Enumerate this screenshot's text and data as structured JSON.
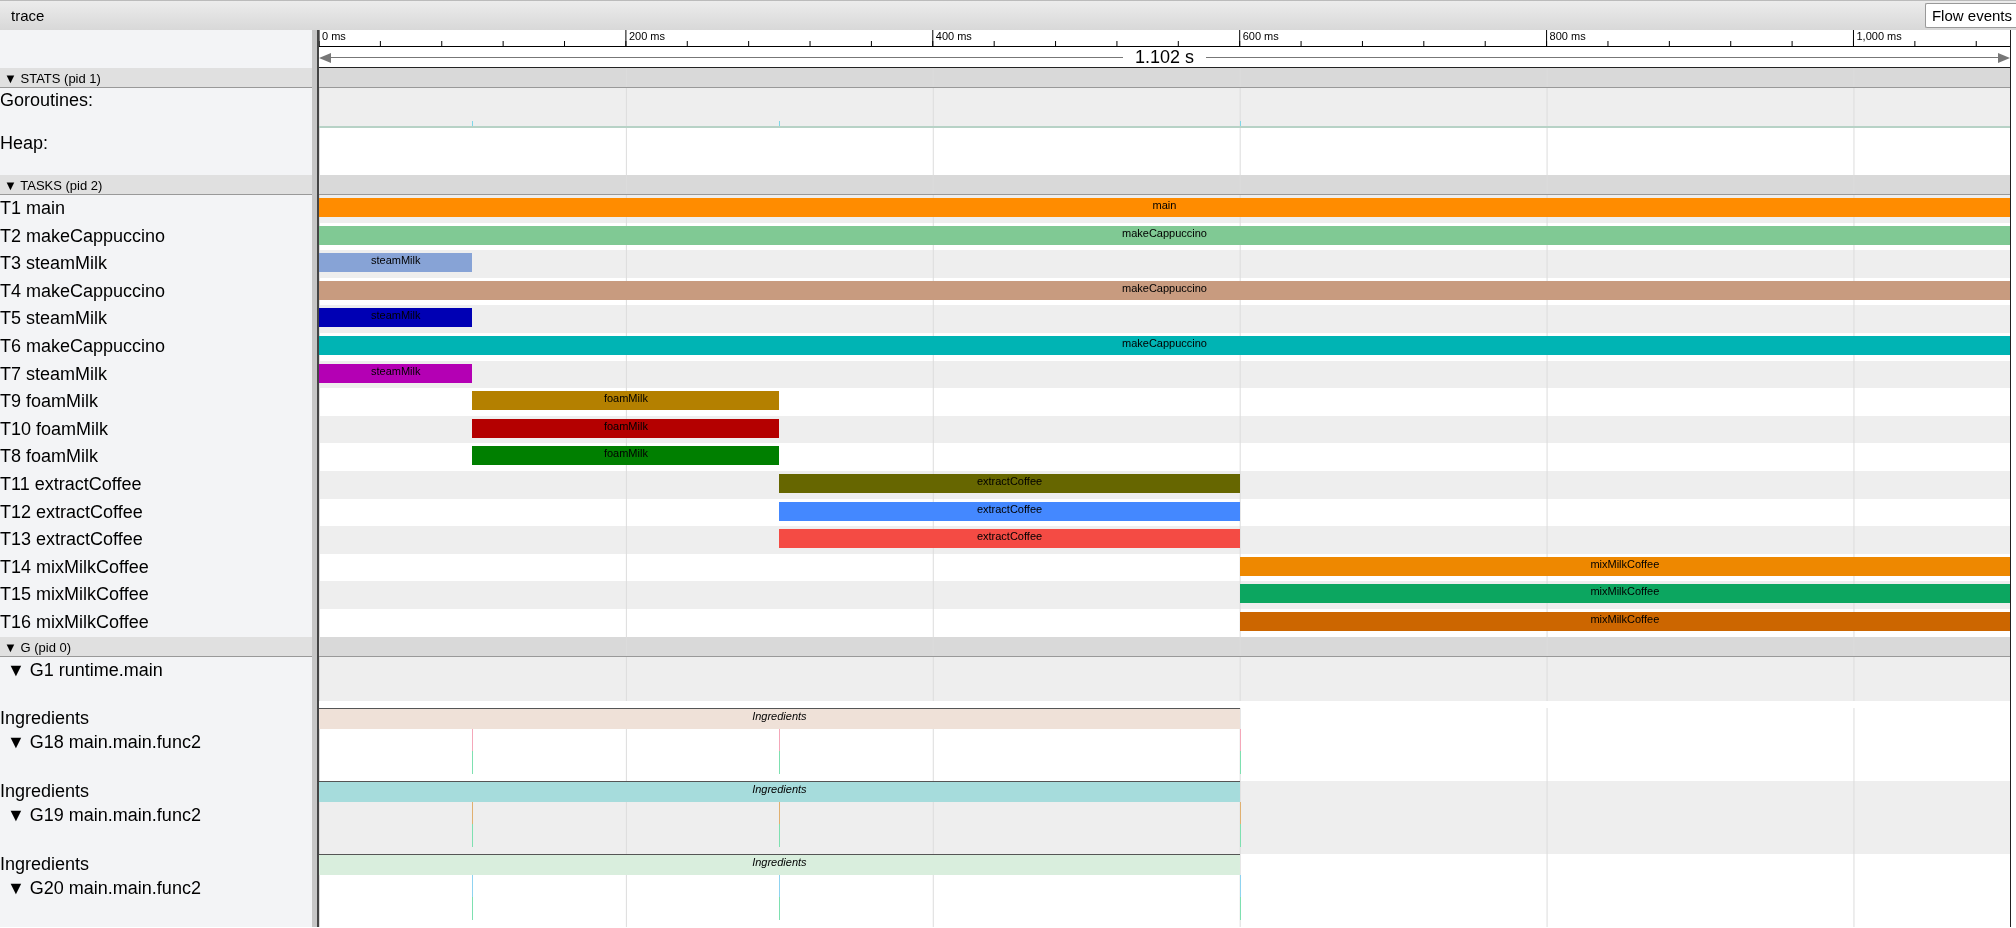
{
  "header": {
    "title": "trace",
    "flow_button": "Flow events"
  },
  "timeline": {
    "duration": "1.102 s",
    "ticks": [
      "0 ms",
      "200 ms",
      "400 ms",
      "600 ms",
      "800 ms",
      "1,000 ms"
    ]
  },
  "sections": [
    {
      "kind": "stats",
      "title": "▼ STATS (pid 1)",
      "rows": [
        {
          "kind": "counter",
          "label": "Goroutines:"
        },
        {
          "kind": "empty",
          "label": "Heap:"
        }
      ]
    },
    {
      "kind": "tasks",
      "title": "▼ TASKS (pid 2)",
      "rows": [
        {
          "label": "T1 main",
          "slice": {
            "name": "main",
            "color": "#ff8c00"
          }
        },
        {
          "label": "T2 makeCappuccino",
          "slice": {
            "name": "makeCappuccino",
            "color": "#80c994"
          }
        },
        {
          "label": "T3 steamMilk",
          "slice": {
            "name": "steamMilk",
            "color": "#87a3d6"
          }
        },
        {
          "label": "T4 makeCappuccino",
          "slice": {
            "name": "makeCappuccino",
            "color": "#c89b7f"
          }
        },
        {
          "label": "T5 steamMilk",
          "slice": {
            "name": "steamMilk",
            "color": "#0000b4"
          }
        },
        {
          "label": "T6 makeCappuccino",
          "slice": {
            "name": "makeCappuccino",
            "color": "#00b4b4"
          }
        },
        {
          "label": "T7 steamMilk",
          "slice": {
            "name": "steamMilk",
            "color": "#b400b4"
          }
        },
        {
          "label": "T9 foamMilk",
          "slice": {
            "name": "foamMilk",
            "color": "#b48000"
          }
        },
        {
          "label": "T10 foamMilk",
          "slice": {
            "name": "foamMilk",
            "color": "#b40000"
          }
        },
        {
          "label": "T8 foamMilk",
          "slice": {
            "name": "foamMilk",
            "color": "#007f00"
          }
        },
        {
          "label": "T11 extractCoffee",
          "slice": {
            "name": "extractCoffee",
            "color": "#666600"
          }
        },
        {
          "label": "T12 extractCoffee",
          "slice": {
            "name": "extractCoffee",
            "color": "#4488ff"
          }
        },
        {
          "label": "T13 extractCoffee",
          "slice": {
            "name": "extractCoffee",
            "color": "#f44b44"
          }
        },
        {
          "label": "T14 mixMilkCoffee",
          "slice": {
            "name": "mixMilkCoffee",
            "color": "#ee8800"
          }
        },
        {
          "label": "T15 mixMilkCoffee",
          "slice": {
            "name": "mixMilkCoffee",
            "color": "#0ca660"
          }
        },
        {
          "label": "T16 mixMilkCoffee",
          "slice": {
            "name": "mixMilkCoffee",
            "color": "#cc6600"
          }
        }
      ]
    },
    {
      "kind": "goroutines",
      "title": "▼ G (pid 0)",
      "rows": [
        {
          "label": "▼ G1 runtime.main"
        },
        {
          "label": "▼ G18 main.main.func2",
          "color": "#f4a7b9",
          "regions": [
            {
              "label": "Ingredients",
              "slice": {
                "name": "Ingredients",
                "color": "#efe1d8"
              }
            }
          ]
        },
        {
          "label": "▼ G19 main.main.func2",
          "color": "#e0b070",
          "regions": [
            {
              "label": "Ingredients",
              "slice": {
                "name": "Ingredients",
                "color": "#a6dcdc"
              }
            }
          ]
        },
        {
          "label": "▼ G20 main.main.func2",
          "color": "#8fd3f0",
          "regions": [
            {
              "label": "Ingredients",
              "slice": {
                "name": "Ingredients",
                "color": "#d9eedd"
              }
            }
          ]
        }
      ]
    }
  ]
}
